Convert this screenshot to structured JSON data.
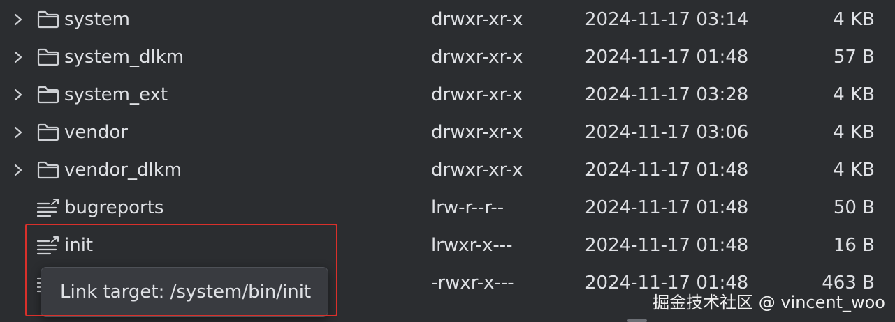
{
  "files": [
    {
      "name": "system",
      "permissions": "drwxr-xr-x",
      "modified": "2024-11-17 03:14",
      "size": "4 KB",
      "type": "folder",
      "icon": "folder-icon"
    },
    {
      "name": "system_dlkm",
      "permissions": "drwxr-xr-x",
      "modified": "2024-11-17 01:48",
      "size": "57 B",
      "type": "folder",
      "icon": "folder-icon"
    },
    {
      "name": "system_ext",
      "permissions": "drwxr-xr-x",
      "modified": "2024-11-17 03:28",
      "size": "4 KB",
      "type": "folder",
      "icon": "folder-icon"
    },
    {
      "name": "vendor",
      "permissions": "drwxr-xr-x",
      "modified": "2024-11-17 03:06",
      "size": "4 KB",
      "type": "folder",
      "icon": "folder-icon"
    },
    {
      "name": "vendor_dlkm",
      "permissions": "drwxr-xr-x",
      "modified": "2024-11-17 01:48",
      "size": "4 KB",
      "type": "folder",
      "icon": "folder-icon"
    },
    {
      "name": "bugreports",
      "permissions": "lrw-r--r--",
      "modified": "2024-11-17 01:48",
      "size": "50 B",
      "type": "symlink",
      "icon": "symlink-file-icon"
    },
    {
      "name": "init",
      "permissions": "lrwxr-x---",
      "modified": "2024-11-17 01:48",
      "size": "16 B",
      "type": "symlink",
      "icon": "symlink-file-icon"
    },
    {
      "name": "",
      "permissions": "-rwxr-x---",
      "modified": "2024-11-17 01:48",
      "size": "463 B",
      "type": "file",
      "icon": "file-icon"
    }
  ],
  "tooltip": {
    "text": "Link target: /system/bin/init"
  },
  "watermark": {
    "text": "掘金技术社区 @ vincent_woo"
  },
  "colors": {
    "background": "#2b2d30",
    "text": "#dfe1e5",
    "highlight_border": "#d9302b",
    "tooltip_bg": "#393b40"
  }
}
